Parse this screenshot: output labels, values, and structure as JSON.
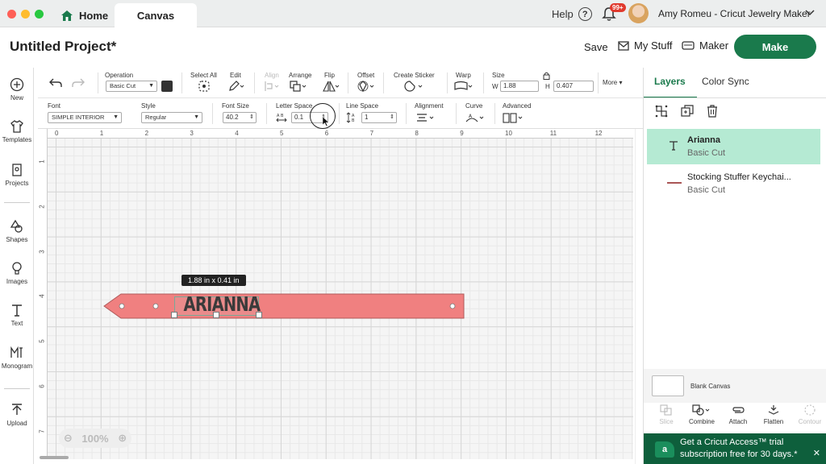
{
  "titlebar": {
    "home_label": "Home",
    "canvas_tab_label": "Canvas",
    "help_label": "Help",
    "notification_count": "99+",
    "user_name": "Amy Romeu - Cricut Jewelry Maker"
  },
  "header": {
    "project_title": "Untitled Project*",
    "save_label": "Save",
    "mystuff_label": "My Stuff",
    "maker_label": "Maker",
    "make_label": "Make"
  },
  "sidebar": {
    "items": [
      {
        "label": "New",
        "icon": "plus-circle-icon"
      },
      {
        "label": "Templates",
        "icon": "shirt-icon"
      },
      {
        "label": "Projects",
        "icon": "projects-icon"
      },
      {
        "label": "Shapes",
        "icon": "shapes-icon"
      },
      {
        "label": "Images",
        "icon": "lightbulb-icon"
      },
      {
        "label": "Text",
        "icon": "text-icon"
      },
      {
        "label": "Monogram",
        "icon": "monogram-icon"
      },
      {
        "label": "Upload",
        "icon": "upload-icon"
      }
    ]
  },
  "toolbar1": {
    "operation_label": "Operation",
    "operation_value": "Basic Cut",
    "operation_color": "#333333",
    "select_all_label": "Select All",
    "edit_label": "Edit",
    "align_label": "Align",
    "arrange_label": "Arrange",
    "flip_label": "Flip",
    "offset_label": "Offset",
    "create_sticker_label": "Create Sticker",
    "warp_label": "Warp",
    "size_label": "Size",
    "w_label": "W",
    "w_value": "1.88",
    "h_label": "H",
    "h_value": "0.407",
    "more_label": "More"
  },
  "toolbar2": {
    "font_label": "Font",
    "font_value": "SIMPLE INTERIOR",
    "style_label": "Style",
    "style_value": "Regular",
    "font_size_label": "Font Size",
    "font_size_value": "40.2",
    "letter_space_label": "Letter Space",
    "letter_space_value": "0.1",
    "line_space_label": "Line Space",
    "line_space_value": "1",
    "alignment_label": "Alignment",
    "curve_label": "Curve",
    "advanced_label": "Advanced"
  },
  "canvas": {
    "ruler_top": [
      "0",
      "1",
      "2",
      "3",
      "4",
      "5",
      "6",
      "7",
      "8",
      "9",
      "10",
      "11",
      "12"
    ],
    "ruler_left": [
      "1",
      "2",
      "3",
      "4",
      "5",
      "6",
      "7"
    ],
    "size_tooltip": "1.88  in x 0.41  in",
    "text_object": "ARIANNA",
    "keychain_color": "#f08080",
    "zoom_value": "100%"
  },
  "layers_panel": {
    "tab_layers": "Layers",
    "tab_color_sync": "Color Sync",
    "layers": [
      {
        "name": "Arianna",
        "operation": "Basic Cut",
        "selected": true
      },
      {
        "name": "Stocking Stuffer Keychai...",
        "operation": "Basic Cut",
        "selected": false
      }
    ],
    "blank_canvas_label": "Blank Canvas",
    "actions": [
      "Slice",
      "Combine",
      "Attach",
      "Flatten",
      "Contour"
    ],
    "banner_line1": "Get a Cricut Access™ trial",
    "banner_line2": "subscription free for 30 days.*"
  },
  "colors": {
    "brand_green": "#1a7a4c",
    "selected_layer_bg": "#b5ead3"
  }
}
